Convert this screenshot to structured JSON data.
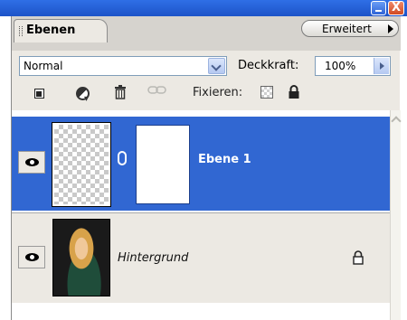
{
  "window": {
    "minimize_icon": "minimize-icon",
    "close_icon": "close-icon",
    "close_glyph": "X"
  },
  "tabs": {
    "active": "Ebenen",
    "menu_button": "Erweitert"
  },
  "blend": {
    "mode": "Normal",
    "opacity_label": "Deckkraft:",
    "opacity_value": "100%"
  },
  "locks": {
    "label": "Fixieren:",
    "icons": [
      "lock-transparent-icon",
      "lock-brush-icon",
      "trash-icon",
      "link-icon",
      "lock-position-icon",
      "lock-all-icon"
    ]
  },
  "layers": [
    {
      "name": "Ebene 1",
      "selected": true,
      "visible": true,
      "thumbnail": "transparent",
      "has_mask": true
    },
    {
      "name": "Hintergrund",
      "selected": false,
      "visible": true,
      "thumbnail": "photo",
      "locked": true
    }
  ],
  "colors": {
    "selection": "#3167d2",
    "panel": "#ece9e3",
    "titlebar": "#1d53c8"
  }
}
